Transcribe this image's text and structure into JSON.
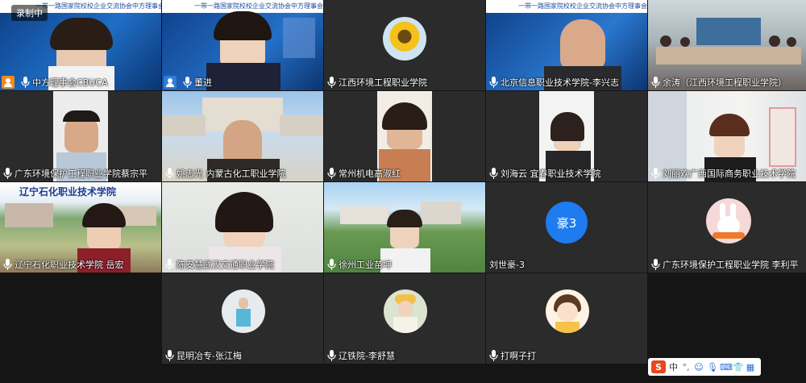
{
  "recording_badge": "录制中",
  "participants": [
    {
      "name": "中方理事会CBUCA",
      "host": true,
      "host_color": "#f08b1d"
    },
    {
      "name": "董进",
      "host": true,
      "host_color": "#2f7bd8"
    },
    {
      "name": "江西环境工程职业学院"
    },
    {
      "name": "北京信息职业技术学院-李兴志"
    },
    {
      "name": "余涛（江西环境工程职业学院）"
    },
    {
      "name": "广东环境保护工程职业学院蔡宗平"
    },
    {
      "name": "姚志光 内蒙古化工职业学院"
    },
    {
      "name": "常州机电高淑红"
    },
    {
      "name": "刘海云 宜春职业技术学院"
    },
    {
      "name": "刘丽欢广西国际商务职业技术学院"
    },
    {
      "name": "辽宁石化职业技术学院  岳宏"
    },
    {
      "name": "陈安慧武汉交通职业学院"
    },
    {
      "name": "徐州工业苗坤"
    },
    {
      "name": "刘世豪-3",
      "avatar_text": "豪3",
      "avatar_color": "#1e7bf0"
    },
    {
      "name": "广东环境保护工程职业学院 李利平"
    },
    {
      "name": "昆明冶专-张江梅"
    },
    {
      "name": "辽铁院-李舒慧"
    },
    {
      "name": "打啊子打"
    }
  ],
  "banner_text": "一带一路国家院校校企业交流协会中方理事会",
  "school_sign": "辽宁石化职业技术学院",
  "ime": {
    "logo": "S",
    "mode": "中"
  }
}
